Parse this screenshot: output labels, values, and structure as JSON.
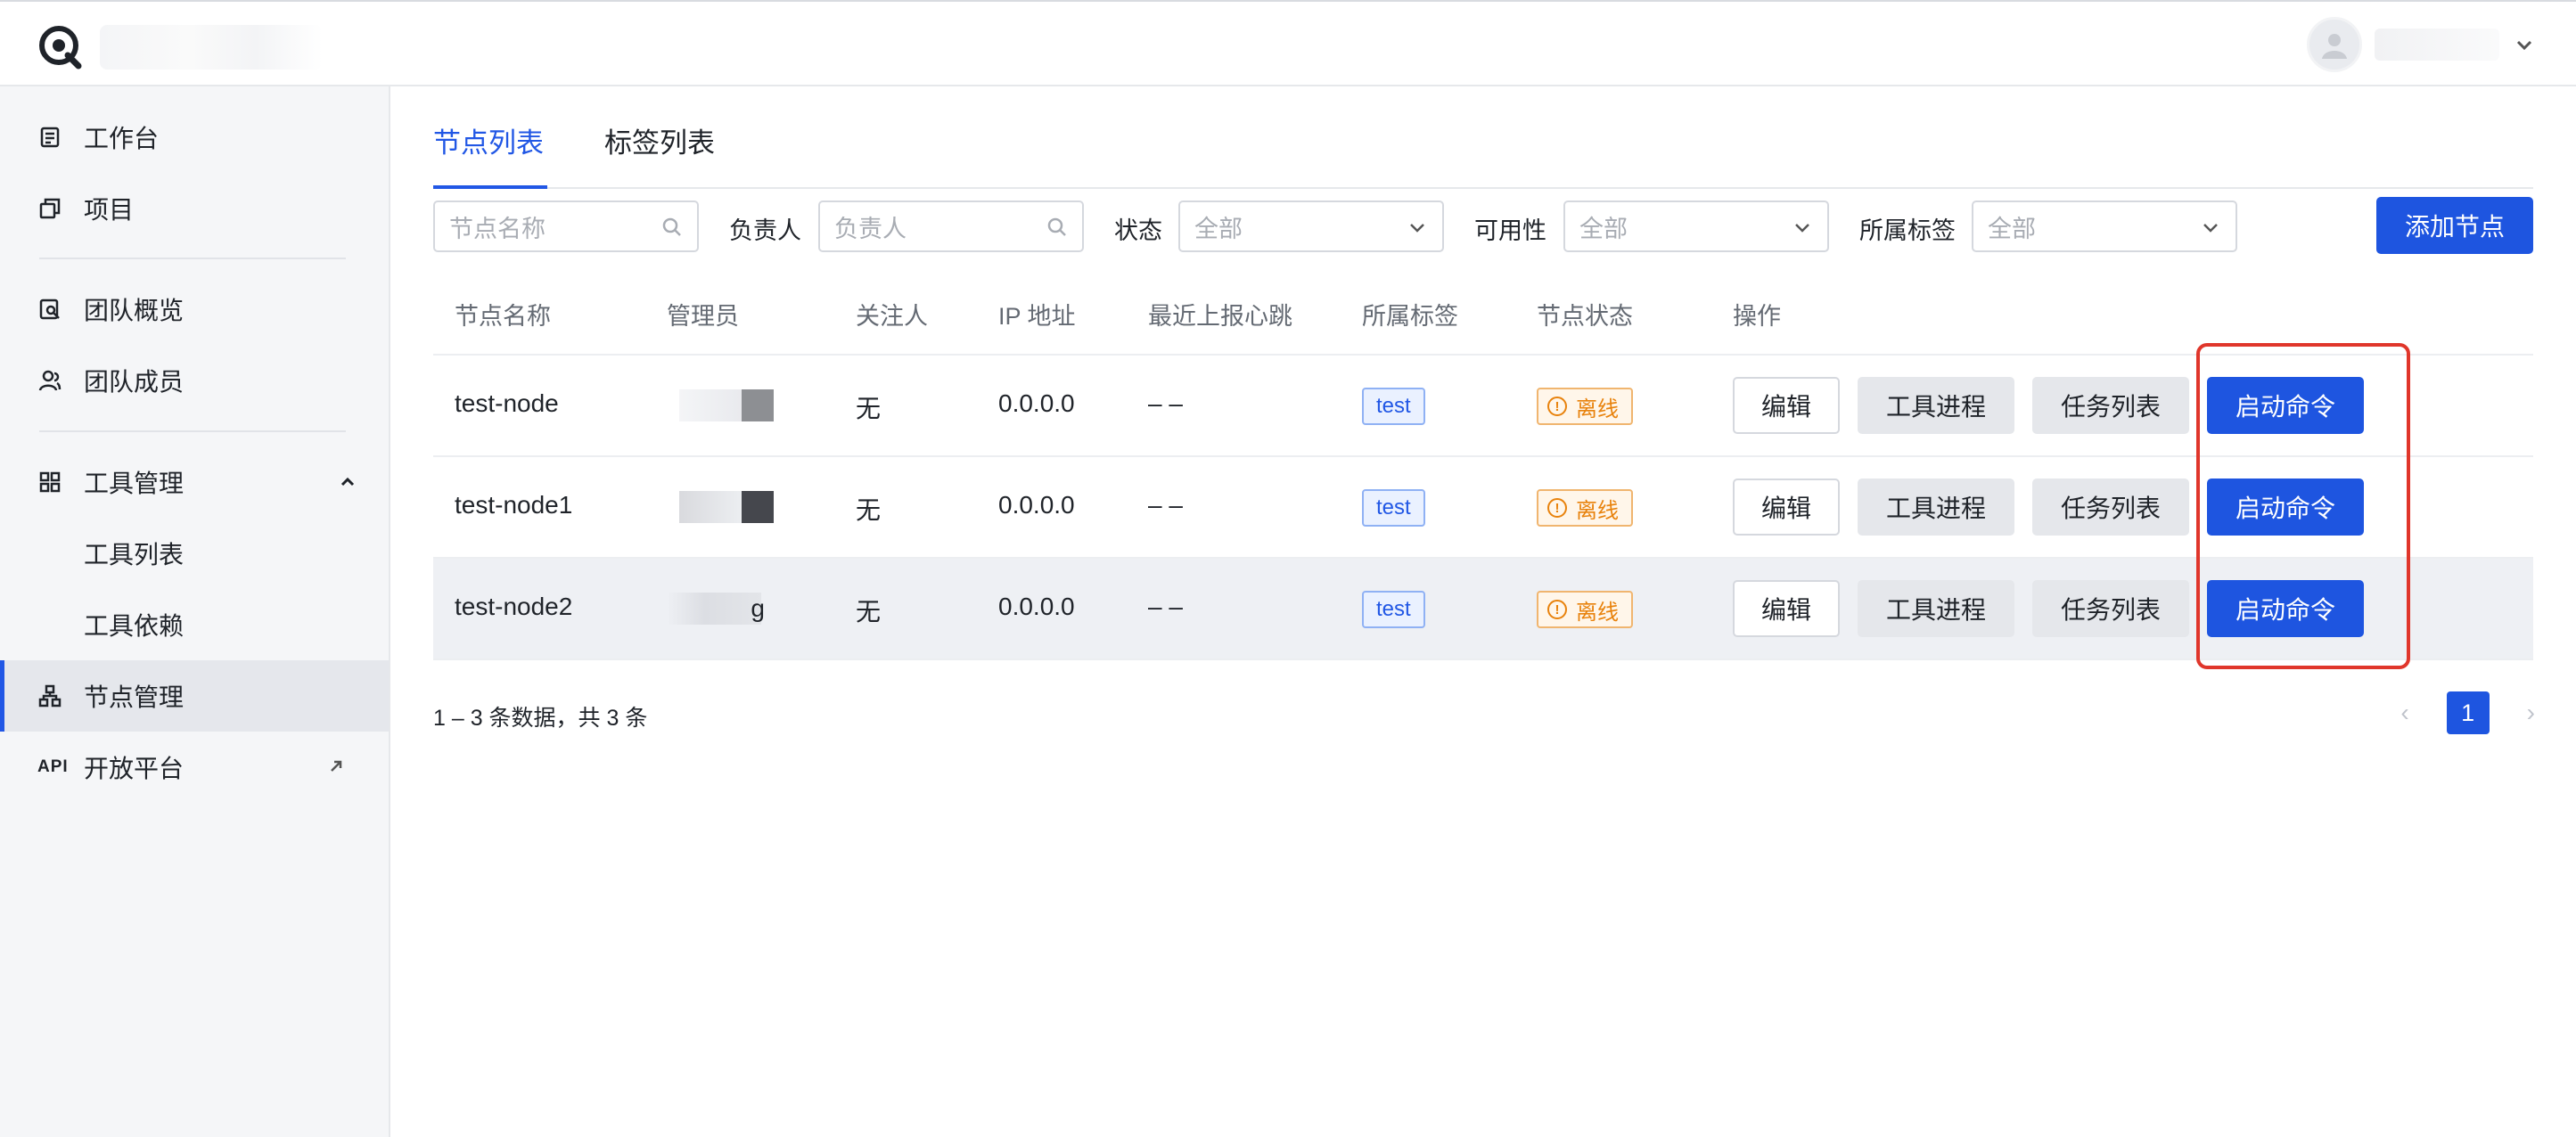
{
  "sidebar": {
    "items": [
      {
        "label": "工作台",
        "icon": "workbench-icon"
      },
      {
        "label": "项目",
        "icon": "project-icon"
      },
      {
        "label": "团队概览",
        "icon": "team-overview-icon"
      },
      {
        "label": "团队成员",
        "icon": "team-members-icon"
      },
      {
        "label": "工具管理",
        "icon": "grid-icon"
      },
      {
        "label": "工具列表"
      },
      {
        "label": "工具依赖"
      },
      {
        "label": "节点管理",
        "icon": "node-tree-icon"
      },
      {
        "label": "开放平台",
        "icon_text": "API"
      }
    ]
  },
  "tabs": [
    "节点列表",
    "标签列表"
  ],
  "filters": {
    "node_name_placeholder": "节点名称",
    "owner_label": "负责人",
    "owner_placeholder": "负责人",
    "status_label": "状态",
    "status_value": "全部",
    "availability_label": "可用性",
    "availability_value": "全部",
    "tag_label": "所属标签",
    "tag_value": "全部",
    "add_button": "添加节点"
  },
  "table": {
    "columns": [
      "节点名称",
      "管理员",
      "关注人",
      "IP 地址",
      "最近上报心跳",
      "所属标签",
      "节点状态",
      "操作"
    ],
    "rows": [
      {
        "name": "test-node",
        "follower": "无",
        "ip": "0.0.0.0",
        "heartbeat": "– –",
        "tag": "test",
        "status": "离线"
      },
      {
        "name": "test-node1",
        "follower": "无",
        "ip": "0.0.0.0",
        "heartbeat": "– –",
        "tag": "test",
        "status": "离线"
      },
      {
        "name": "test-node2",
        "admin_visible": "g",
        "follower": "无",
        "ip": "0.0.0.0",
        "heartbeat": "– –",
        "tag": "test",
        "status": "离线"
      }
    ],
    "actions": {
      "edit": "编辑",
      "process": "工具进程",
      "tasks": "任务列表",
      "start": "启动命令"
    }
  },
  "pagination": {
    "info": "1 – 3 条数据，共 3 条",
    "current_page": "1",
    "prev": "‹",
    "next": "›"
  },
  "colors": {
    "accent": "#1e55e0",
    "highlight": "#e0362b",
    "offline": "#e8820c"
  }
}
